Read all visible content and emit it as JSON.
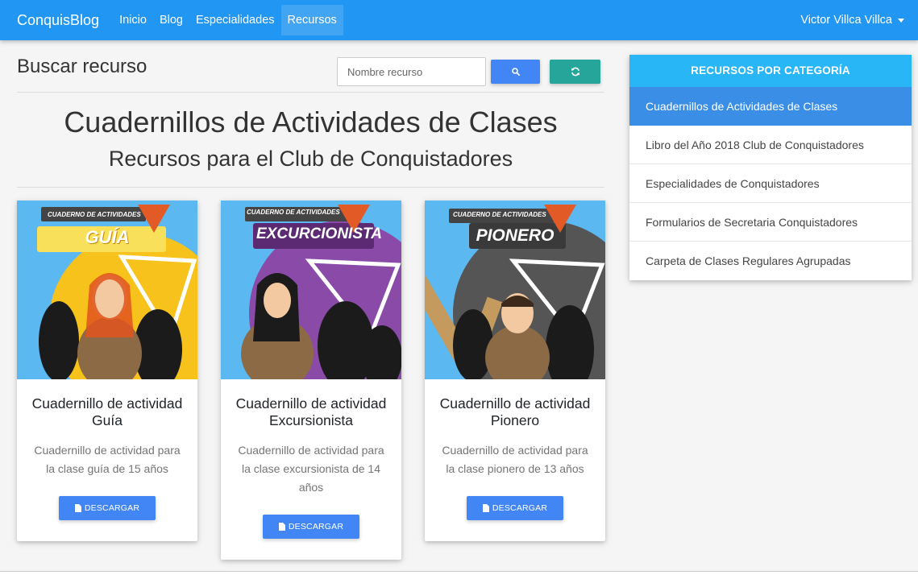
{
  "navbar": {
    "brand": "ConquisBlog",
    "links": [
      "Inicio",
      "Blog",
      "Especialidades",
      "Recursos"
    ],
    "active": "Recursos",
    "user": "Victor Villca Villca"
  },
  "search": {
    "title": "Buscar recurso",
    "placeholder": "Nombre recurso"
  },
  "heading": {
    "title": "Cuadernillos de Actividades de Clases",
    "subtitle": "Recursos para el Club de Conquistadores"
  },
  "cards": [
    {
      "banner_top": "CUADERNO DE ACTIVIDADES",
      "banner_name": "GUÍA",
      "title": "Cuadernillo de actividad Guía",
      "text": "Cuadernillo de actividad para la clase guía de 15 años",
      "button": "DESCARGAR",
      "bg_color": "#f7c21b"
    },
    {
      "banner_top": "CUADERNO DE ACTIVIDADES",
      "banner_name": "EXCURCIONISTA",
      "title": "Cuadernillo de actividad Excursionista",
      "text": "Cuadernillo de actividad para la clase excursionista de 14 años",
      "button": "DESCARGAR",
      "bg_color": "#8a4aa8"
    },
    {
      "banner_top": "CUADERNO DE ACTIVIDADES",
      "banner_name": "PIONERO",
      "title": "Cuadernillo de actividad Pionero",
      "text": "Cuadernillo de actividad para la clase pionero de 13 años",
      "button": "DESCARGAR",
      "bg_color": "#555555"
    }
  ],
  "sidebar": {
    "header": "RECURSOS POR CATEGORÍA",
    "items": [
      "Cuadernillos de Actividades de Clases",
      "Libro del Año 2018 Club de Conquistadores",
      "Especialidades de Conquistadores",
      "Formularios de Secretaria Conquistadores",
      "Carpeta de Clases Regulares Agrupadas"
    ],
    "active_index": 0
  },
  "colors": {
    "navbar": "#2196f3",
    "primary_button": "#4285f4",
    "refresh_button": "#26a69a",
    "sidebar_header": "#29b6f6",
    "sidebar_active": "#3a8ee6"
  },
  "icons": [
    "search-icon",
    "refresh-icon",
    "file-icon",
    "caret-down-icon"
  ]
}
